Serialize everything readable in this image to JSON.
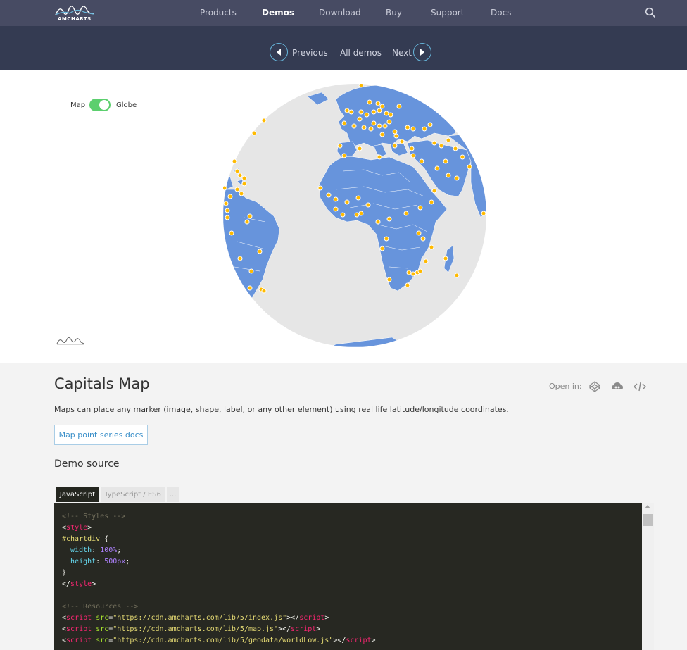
{
  "nav": {
    "logo_text": "AMCHARTS",
    "items": [
      {
        "label": "Products",
        "active": false
      },
      {
        "label": "Demos",
        "active": true
      },
      {
        "label": "Download",
        "active": false
      },
      {
        "label": "Buy",
        "active": false
      },
      {
        "label": "Support",
        "active": false
      },
      {
        "label": "Docs",
        "active": false
      }
    ],
    "search_icon": "search-icon"
  },
  "demo_nav": {
    "previous": "Previous",
    "all": "All demos",
    "next": "Next"
  },
  "chart": {
    "toggle_left": "Map",
    "toggle_right": "Globe",
    "toggle_on": true,
    "colors": {
      "land": "#6794dc",
      "ocean": "#e6e6e6",
      "marker_fill": "#ffba00",
      "marker_stroke": "#ffffff",
      "toggle": "#5ccf6e"
    }
  },
  "content": {
    "title": "Capitals Map",
    "open_in": "Open in:",
    "open_in_icons": [
      "codepen-icon",
      "cloud-icon",
      "code-icon"
    ],
    "description": "Maps can place any marker (image, shape, label, or any other element) using real life latitude/longitude coordinates.",
    "docs_button": "Map point series docs",
    "demo_source": "Demo source"
  },
  "code_tabs": [
    "JavaScript",
    "TypeScript / ES6",
    "..."
  ],
  "code": {
    "l1": "<!-- Styles -->",
    "l2_tag": "style",
    "l3_sel": "#chartdiv",
    "l4_prop": "width",
    "l4_val": "100%",
    "l5_prop": "height",
    "l5_val": "500px",
    "l9": "<!-- Resources -->",
    "src1": "\"https://cdn.amcharts.com/lib/5/index.js\"",
    "src2": "\"https://cdn.amcharts.com/lib/5/map.js\"",
    "src3": "\"https://cdn.amcharts.com/lib/5/geodata/worldLow.js\""
  }
}
